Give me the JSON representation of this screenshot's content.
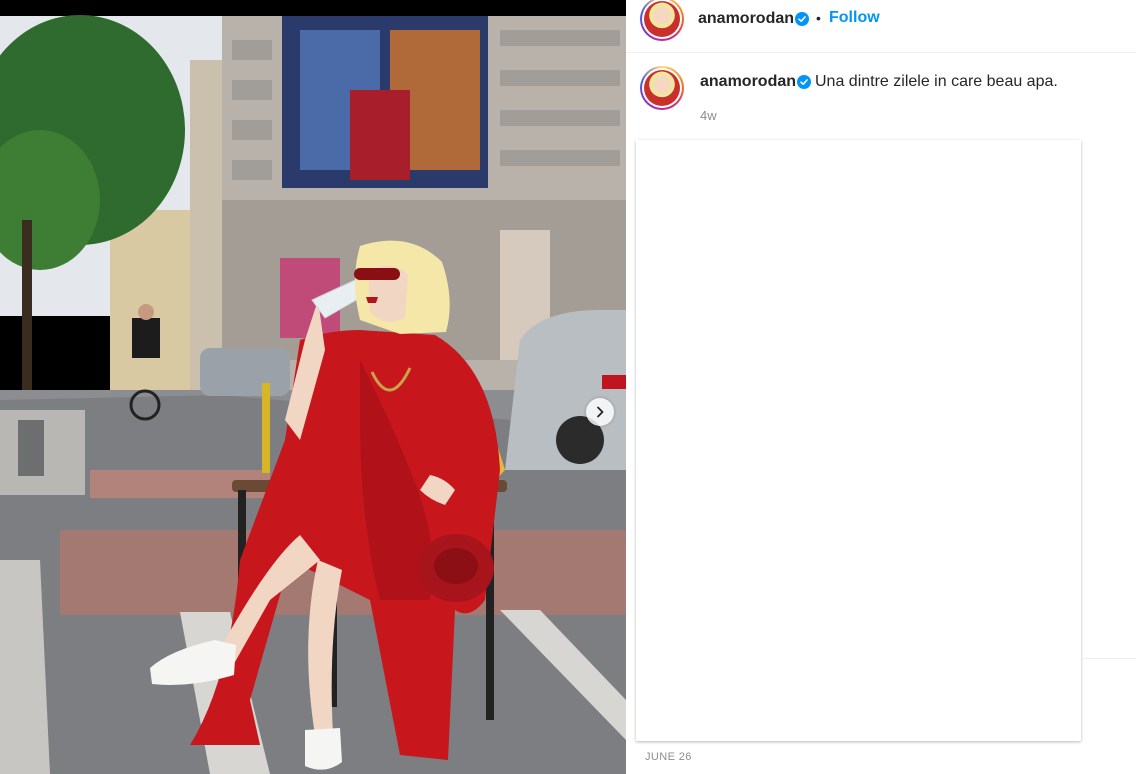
{
  "post": {
    "username": "anamorodan",
    "verified": true,
    "follow_label": "Follow",
    "separator": "•",
    "caption": "Una dintre zilele in care beau apa.",
    "time_ago": "4w",
    "date": "JUNE 26"
  },
  "icons": {
    "verified": "verified-badge-icon",
    "next": "chevron-right-icon"
  },
  "colors": {
    "follow": "#0095f6",
    "verified": "#0095f6",
    "muted": "#8e8e8e",
    "dress": "#c8161d"
  }
}
